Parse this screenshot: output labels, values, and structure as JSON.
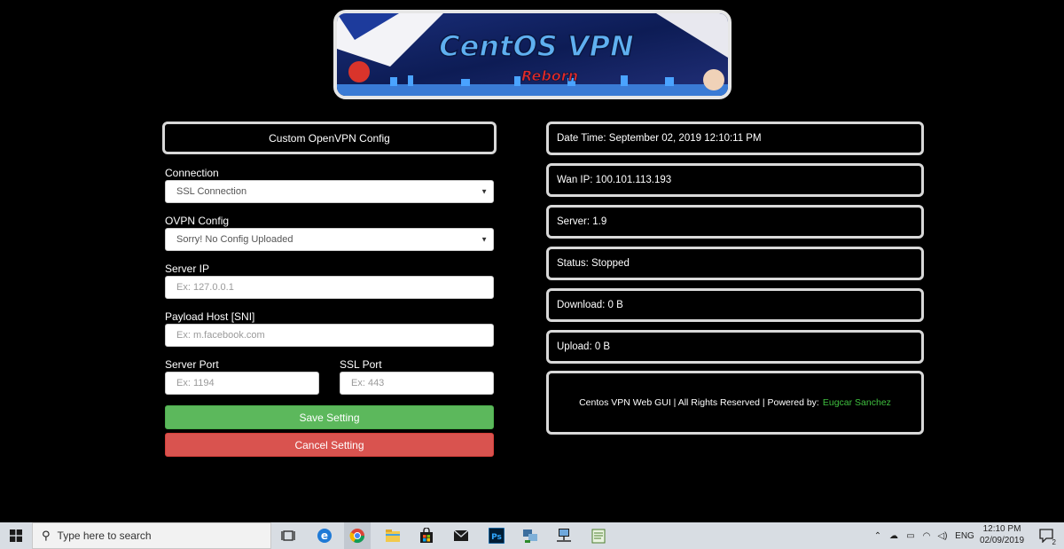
{
  "banner": {
    "title": "CentOS VPN",
    "subtitle": "Reborn"
  },
  "form": {
    "title": "Custom OpenVPN Config",
    "connection_label": "Connection",
    "connection_value": "SSL Connection",
    "ovpn_label": "OVPN Config",
    "ovpn_value": "Sorry! No Config Uploaded",
    "server_ip_label": "Server IP",
    "server_ip_placeholder": "Ex: 127.0.0.1",
    "payload_label": "Payload Host [SNI]",
    "payload_placeholder": "Ex: m.facebook.com",
    "server_port_label": "Server Port",
    "server_port_placeholder": "Ex: 1194",
    "ssl_port_label": "SSL Port",
    "ssl_port_placeholder": "Ex: 443",
    "save_label": "Save Setting",
    "cancel_label": "Cancel Setting"
  },
  "status": {
    "datetime": "Date Time: September 02, 2019 12:10:11 PM",
    "wan_ip": "Wan IP: 100.101.113.193",
    "server": "Server: 1.9",
    "status": "Status: Stopped",
    "download": "Download: 0 B",
    "upload": "Upload: 0 B"
  },
  "footer": {
    "text": "Centos VPN Web GUI | All Rights Reserved | Powered by:",
    "author": "Eugcar Sanchez",
    "author_color": "#3fbf3f"
  },
  "taskbar": {
    "search_placeholder": "Type here to search",
    "apps": [
      "task-view-icon",
      "edge-icon",
      "chrome-icon",
      "file-explorer-icon",
      "store-icon",
      "mail-icon",
      "photoshop-icon",
      "network-tool-icon",
      "remote-desktop-icon",
      "notepad-icon"
    ],
    "photoshop_label": "Ps",
    "language": "ENG",
    "time": "12:10 PM",
    "date": "02/09/2019",
    "notification_count": "2"
  },
  "colors": {
    "save": "#5cb85c",
    "cancel": "#d9534f",
    "background": "#000000",
    "border": "#d9d9d9"
  }
}
